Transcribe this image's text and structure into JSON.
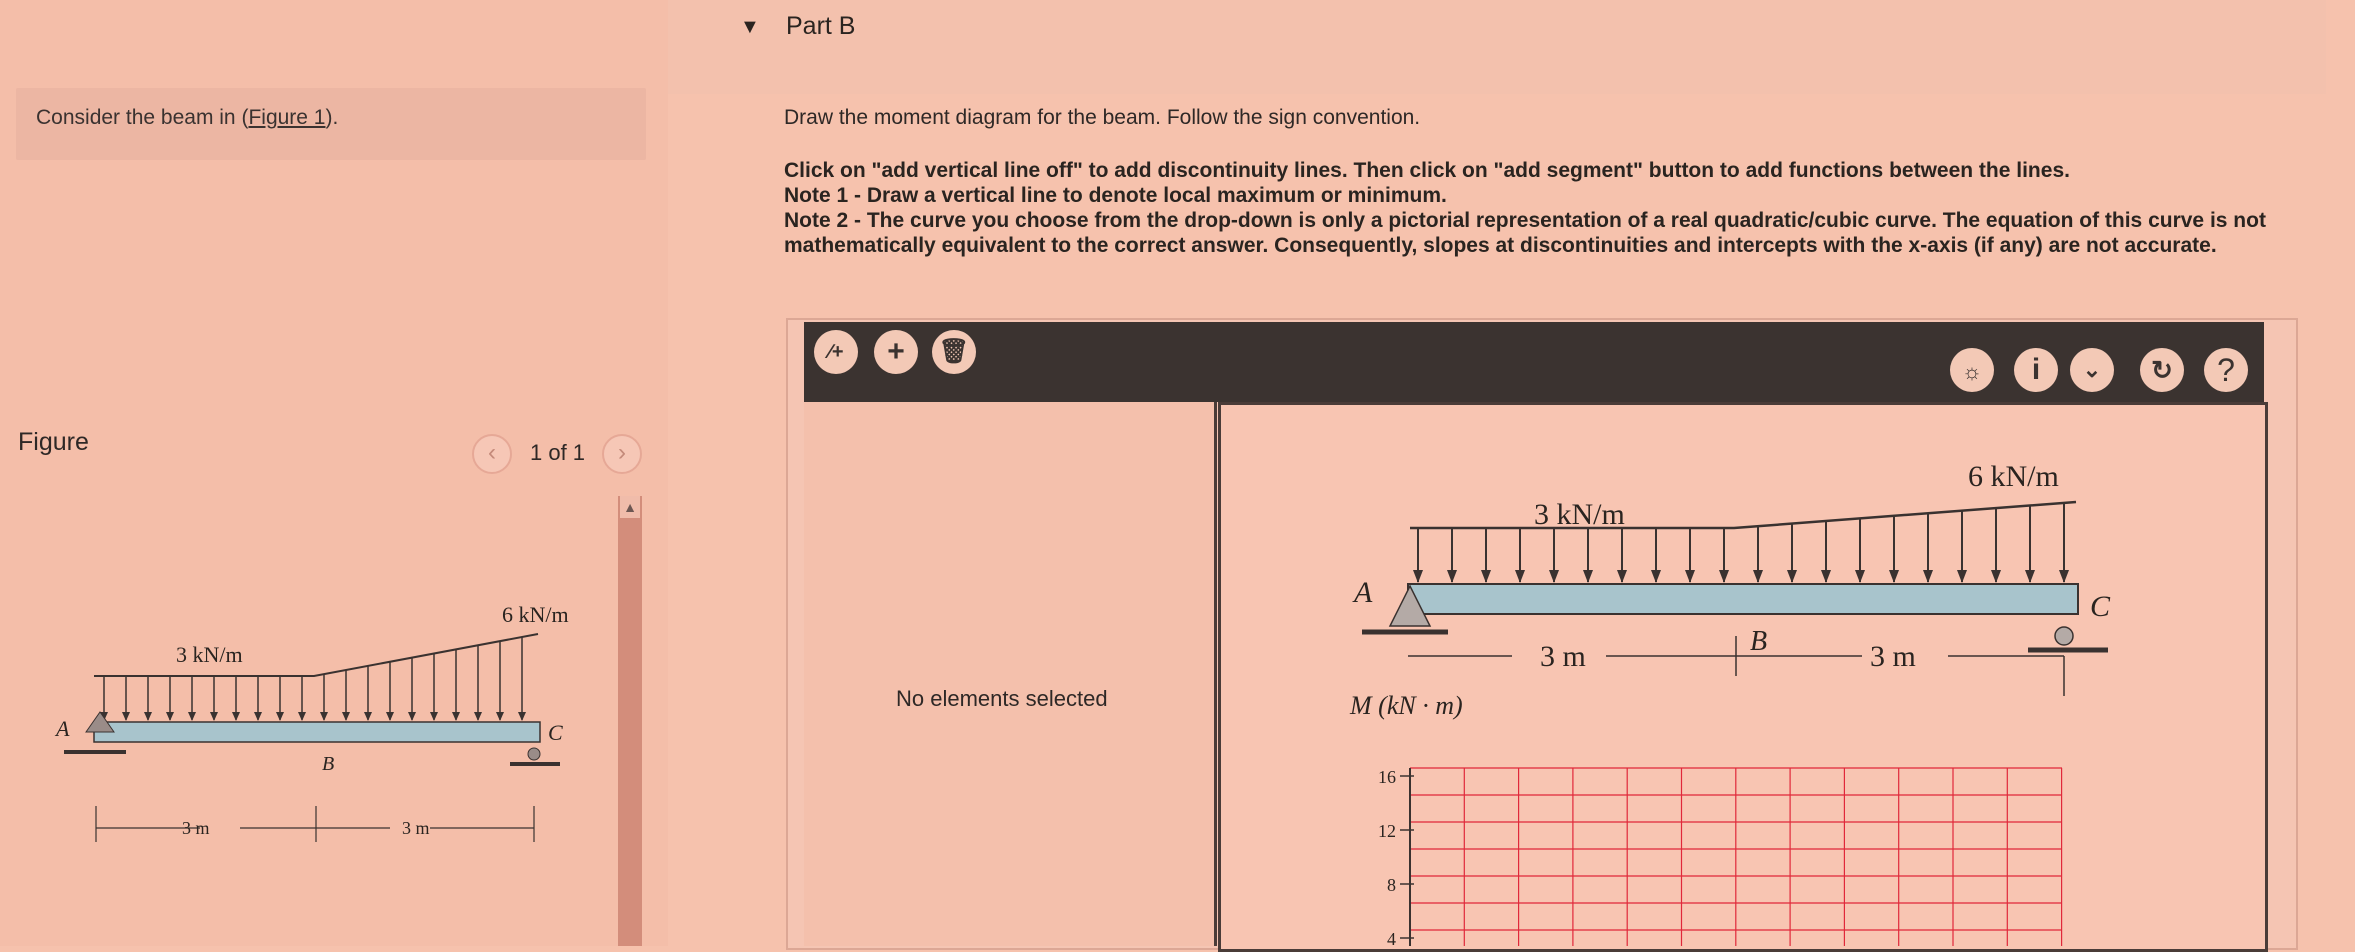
{
  "intro": {
    "prefix": "Consider the beam in (",
    "link": "Figure 1",
    "suffix": ")."
  },
  "figure": {
    "label": "Figure",
    "page_counter": "1 of 1",
    "prev_icon": "chevron-left-icon",
    "next_icon": "chevron-right-icon",
    "beam": {
      "left_load": "3 kN/m",
      "right_load": "6 kN/m",
      "point_a": "A",
      "point_b": "B",
      "point_c": "C",
      "span_left": "3 m",
      "span_right": "3 m"
    }
  },
  "part": {
    "title": "Part B",
    "instruction": "Draw the moment diagram for the beam. Follow the sign convention.",
    "bold_lines": [
      "Click on \"add vertical line off\" to add discontinuity lines. Then click on \"add segment\" button to add functions between the lines.",
      "Note 1 - Draw a vertical line to denote local maximum or minimum.",
      "Note 2 - The curve you choose from the drop-down is only a pictorial representation of a real quadratic/cubic curve. The equation of this curve is not mathematically equivalent to the correct answer. Consequently, slopes at discontinuities and intercepts with the x-axis (if any) are not accurate."
    ]
  },
  "toolbar": {
    "vertical_line_icon": "add-vertical-line-icon",
    "add_segment_icon": "plus-icon",
    "delete_icon": "trash-icon",
    "hint_icon": "lightbulb-icon",
    "info_icon": "info-icon",
    "chevron_icon": "chevron-down-icon",
    "redo_icon": "redo-icon",
    "help_icon": "help-icon"
  },
  "properties": {
    "empty_text": "No elements selected"
  },
  "canvas": {
    "beam": {
      "left_load": "3 kN/m",
      "right_load": "6 kN/m",
      "point_a": "A",
      "point_b": "B",
      "point_c": "C",
      "span_left": "3 m",
      "span_right": "3 m"
    },
    "moment_axis_label": "M (kN · m)",
    "y_ticks": [
      "16",
      "12",
      "8",
      "4"
    ]
  },
  "colors": {
    "grid": "#e0283a",
    "beam": "#a8c4cc",
    "toolbar": "#3b3330"
  }
}
